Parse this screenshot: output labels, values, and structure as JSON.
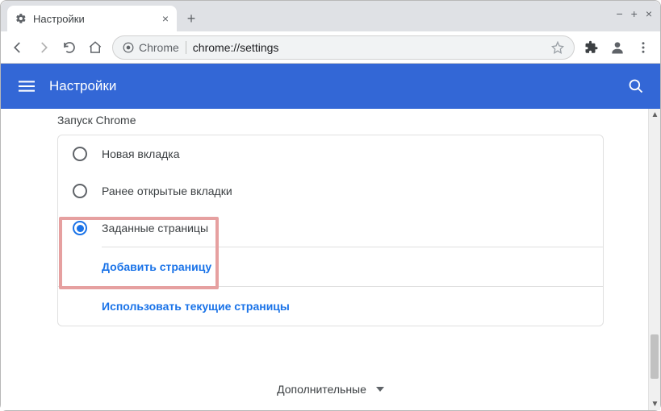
{
  "browser": {
    "tab_title": "Настройки",
    "omnibox_label": "Chrome",
    "omnibox_url": "chrome://settings"
  },
  "header": {
    "title": "Настройки"
  },
  "content": {
    "section_heading": "Запуск Chrome",
    "options": [
      {
        "label": "Новая вкладка",
        "selected": false
      },
      {
        "label": "Ранее открытые вкладки",
        "selected": false
      },
      {
        "label": "Заданные страницы",
        "selected": true
      }
    ],
    "add_page_label": "Добавить страницу",
    "use_current_label": "Использовать текущие страницы",
    "advanced_label": "Дополнительные"
  }
}
